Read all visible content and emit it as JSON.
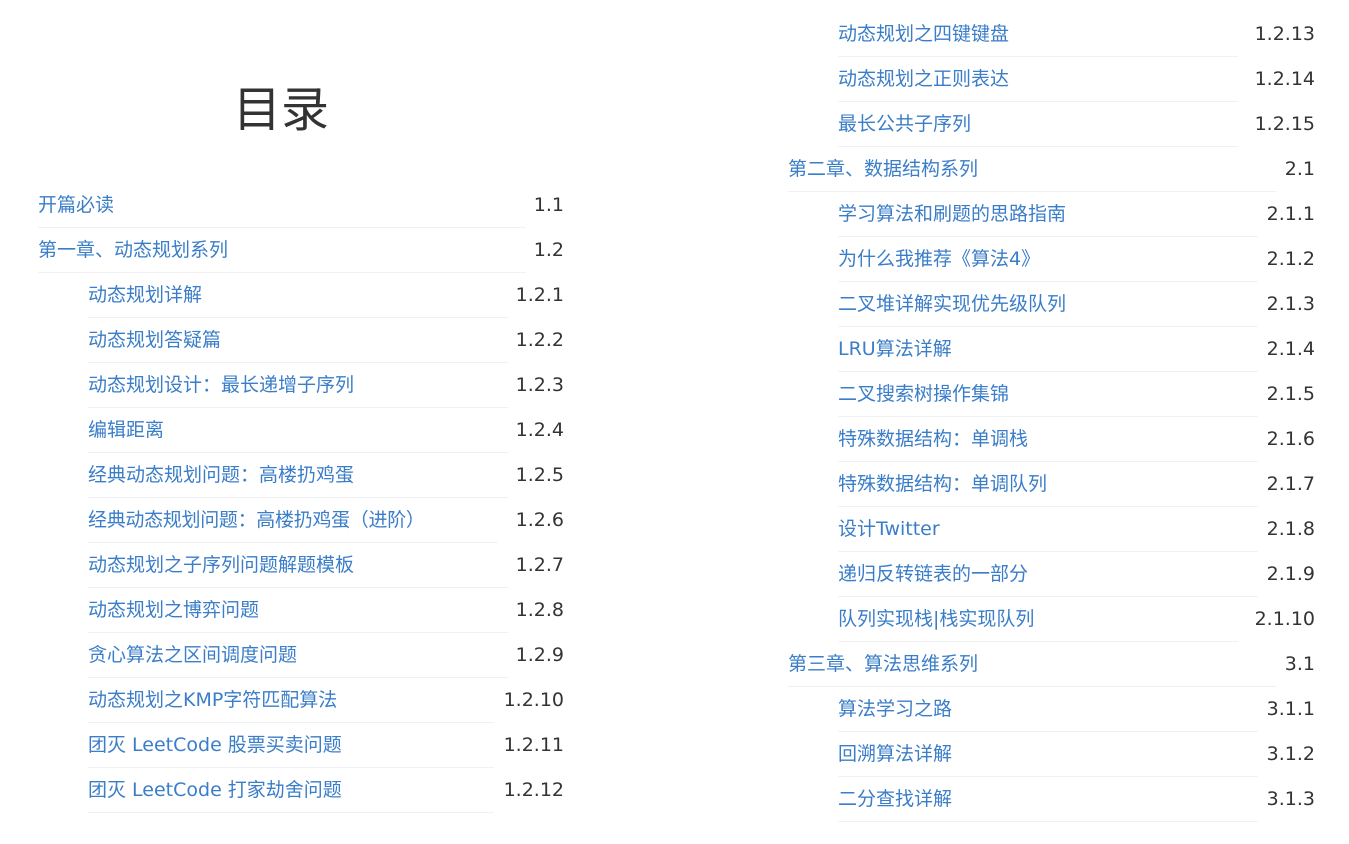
{
  "title": "目录",
  "entries": [
    {
      "label": "开篇必读",
      "num": "1.1"
    },
    {
      "label": "第一章、动态规划系列",
      "num": "1.2"
    },
    {
      "label": "动态规划详解",
      "num": "1.2.1"
    },
    {
      "label": "动态规划答疑篇",
      "num": "1.2.2"
    },
    {
      "label": "动态规划设计：最长递增子序列",
      "num": "1.2.3"
    },
    {
      "label": "编辑距离",
      "num": "1.2.4"
    },
    {
      "label": "经典动态规划问题：高楼扔鸡蛋",
      "num": "1.2.5"
    },
    {
      "label": "经典动态规划问题：高楼扔鸡蛋（进阶）",
      "num": "1.2.6"
    },
    {
      "label": "动态规划之子序列问题解题模板",
      "num": "1.2.7"
    },
    {
      "label": "动态规划之博弈问题",
      "num": "1.2.8"
    },
    {
      "label": "贪心算法之区间调度问题",
      "num": "1.2.9"
    },
    {
      "label": "动态规划之KMP字符匹配算法",
      "num": "1.2.10"
    },
    {
      "label": "团灭 LeetCode 股票买卖问题",
      "num": "1.2.11"
    },
    {
      "label": "团灭 LeetCode 打家劫舍问题",
      "num": "1.2.12"
    },
    {
      "label": "动态规划之四键键盘",
      "num": "1.2.13"
    },
    {
      "label": "动态规划之正则表达",
      "num": "1.2.14"
    },
    {
      "label": "最长公共子序列",
      "num": "1.2.15"
    },
    {
      "label": "第二章、数据结构系列",
      "num": "2.1"
    },
    {
      "label": "学习算法和刷题的思路指南",
      "num": "2.1.1"
    },
    {
      "label": "为什么我推荐《算法4》",
      "num": "2.1.2"
    },
    {
      "label": "二叉堆详解实现优先级队列",
      "num": "2.1.3"
    },
    {
      "label": "LRU算法详解",
      "num": "2.1.4"
    },
    {
      "label": "二叉搜索树操作集锦",
      "num": "2.1.5"
    },
    {
      "label": "特殊数据结构：单调栈",
      "num": "2.1.6"
    },
    {
      "label": "特殊数据结构：单调队列",
      "num": "2.1.7"
    },
    {
      "label": "设计Twitter",
      "num": "2.1.8"
    },
    {
      "label": "递归反转链表的一部分",
      "num": "2.1.9"
    },
    {
      "label": "队列实现栈|栈实现队列",
      "num": "2.1.10"
    },
    {
      "label": "第三章、算法思维系列",
      "num": "3.1"
    },
    {
      "label": "算法学习之路",
      "num": "3.1.1"
    },
    {
      "label": "回溯算法详解",
      "num": "3.1.2"
    },
    {
      "label": "二分查找详解",
      "num": "3.1.3"
    }
  ]
}
